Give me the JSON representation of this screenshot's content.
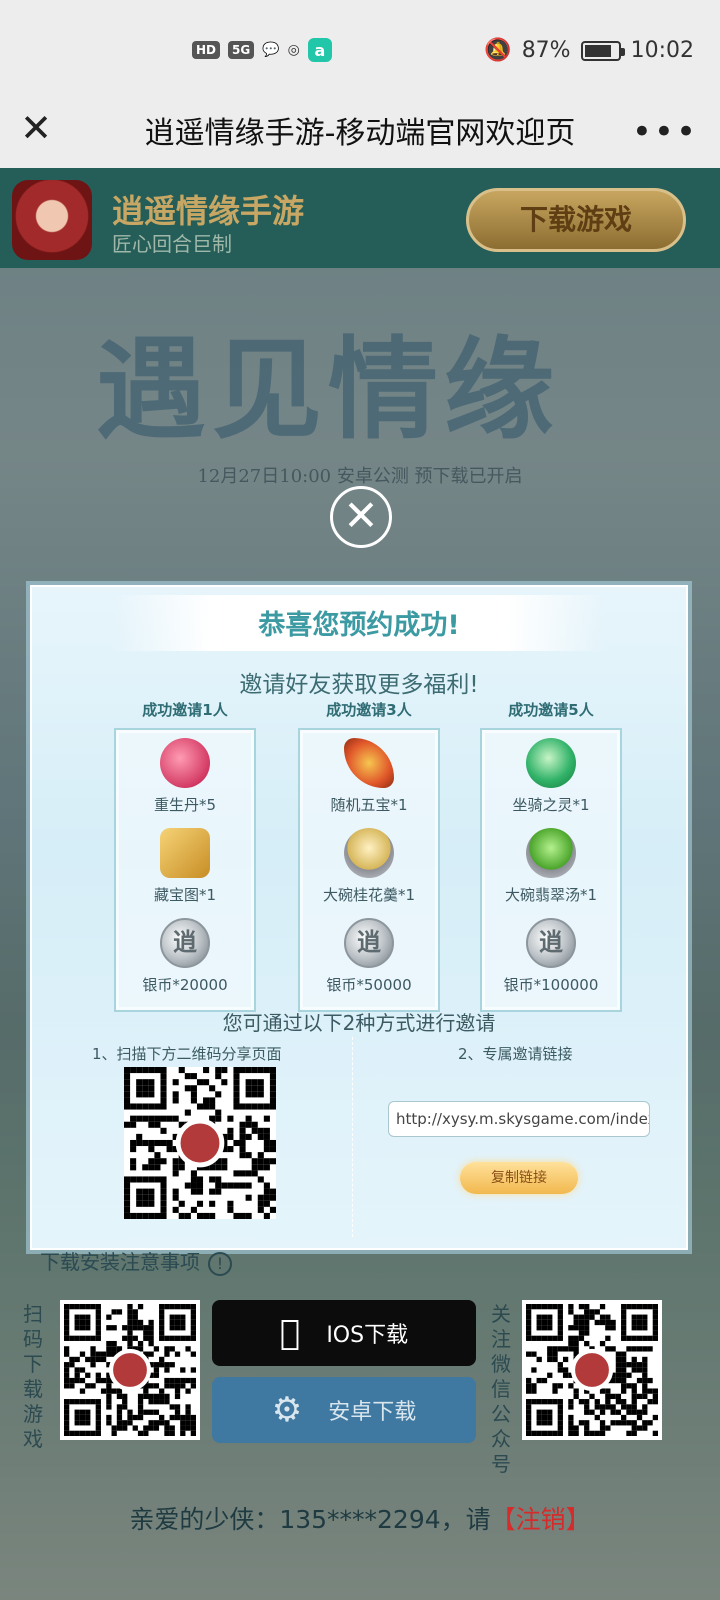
{
  "status_bar": {
    "network": [
      "HD",
      "5G"
    ],
    "battery_percent": "87%",
    "battery_level": 0.87,
    "time": "10:02"
  },
  "titlebar": {
    "title": "逍遥情缘手游-移动端官网欢迎页"
  },
  "banner": {
    "app_name": "逍遥情缘手游",
    "slogan": "匠心回合巨制",
    "download_label": "下载游戏"
  },
  "hero": {
    "title": "遇见情缘",
    "subtitle": "12月27日10:00 安卓公测  预下载已开启"
  },
  "modal": {
    "title": "恭喜您预约成功!",
    "subtitle": "邀请好友获取更多福利!",
    "tiers": [
      {
        "heading": "成功邀请1人",
        "rewards": [
          {
            "icon": "revival-pill-icon",
            "label": "重生丹*5"
          },
          {
            "icon": "treasure-map-icon",
            "label": "藏宝图*1"
          },
          {
            "icon": "silver-coin-icon",
            "label": "银币*20000"
          }
        ]
      },
      {
        "heading": "成功邀请3人",
        "rewards": [
          {
            "icon": "feather-treasure-icon",
            "label": "随机五宝*1"
          },
          {
            "icon": "osmanthus-soup-icon",
            "label": "大碗桂花羹*1"
          },
          {
            "icon": "silver-coin-icon",
            "label": "银币*50000"
          }
        ]
      },
      {
        "heading": "成功邀请5人",
        "rewards": [
          {
            "icon": "mount-spirit-icon",
            "label": "坐骑之灵*1"
          },
          {
            "icon": "jade-soup-icon",
            "label": "大碗翡翠汤*1"
          },
          {
            "icon": "silver-coin-icon",
            "label": "银币*100000"
          }
        ]
      }
    ],
    "coin_glyph": "逍",
    "invite_title": "您可通过以下2种方式进行邀请",
    "method1": "1、扫描下方二维码分享页面",
    "method2": "2、专属邀请链接",
    "invite_link": "http://xysy.m.skysgame.com/index",
    "copy_label": "复制链接"
  },
  "bottom": {
    "notice": "下载安装注意事项",
    "scan_text": "扫码下载游戏",
    "ios_label": "IOS下载",
    "android_label": "安卓下载",
    "follow_text": "关注微信公众号",
    "greeting_prefix": "亲爱的少侠：135****2294，请",
    "logout_label": "【注销】"
  }
}
